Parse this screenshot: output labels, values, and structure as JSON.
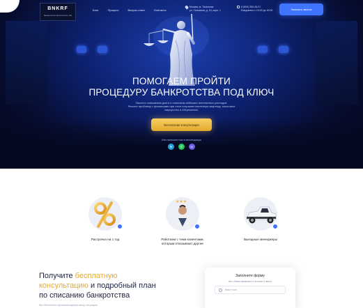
{
  "header": {
    "logo_title": "BNKRF",
    "logo_subtitle": "банкротство физических лиц",
    "nav": [
      "Блог",
      "Процесс",
      "Вопрос-ответ",
      "Контакты"
    ],
    "address_line1": "Москва, м. Таганская",
    "address_line2": "ул. Таганская, д. 24, корп. 1",
    "phone_number": "8 (800) 350-45-21",
    "work_hours": "Ежедневно с 10:00 до 20:00",
    "cta_label": "Заказать звонок"
  },
  "hero": {
    "title_line1": "ПОМОГАЕМ ПРОЙТИ",
    "title_line2": "ПРОЦЕДУРУ БАНКРОТСТВА ПОД КЛЮЧ",
    "subtitle_line1": "Законно списываем долги и помогаем избежать неоплатных расходов.",
    "subtitle_line2": "Решите проблему с финансами при этом сохранив ипотечную квартиру, залоговое",
    "subtitle_line3": "имущество и сбережения.",
    "cta_label": "Бесплатная консультация",
    "messengers_note": "Или напишите нам в мессенджеры",
    "messengers": [
      {
        "icon": "telegram-icon",
        "glyph": "➤"
      },
      {
        "icon": "whatsapp-icon",
        "glyph": "✆"
      },
      {
        "icon": "viber-icon",
        "glyph": "☏"
      }
    ]
  },
  "features": [
    {
      "label_a": "Рассрочка на 1 год",
      "label_b": ""
    },
    {
      "label_a": "Работаем с теми клиентами,",
      "label_b": "которым отказывают другие"
    },
    {
      "label_a": "Выездные менеджеры",
      "label_b": ""
    }
  ],
  "consultation": {
    "line1": "Получите ",
    "highlight1": "бесплатную",
    "highlight2": "консультацию",
    "line2_rest": " и подробный план",
    "line3": "по списанию банкротства",
    "note": "Мы бесплатно проанализируем вашу ситуацию"
  },
  "form": {
    "title": "Заполните форму",
    "subtitle": "Мы с Вами свяжемся в течение 5 минут",
    "name_placeholder": "Ваше имя"
  },
  "colors": {
    "accent": "#3e74ff",
    "gold": "#e5a92f",
    "hero_dark": "#060c2e"
  }
}
